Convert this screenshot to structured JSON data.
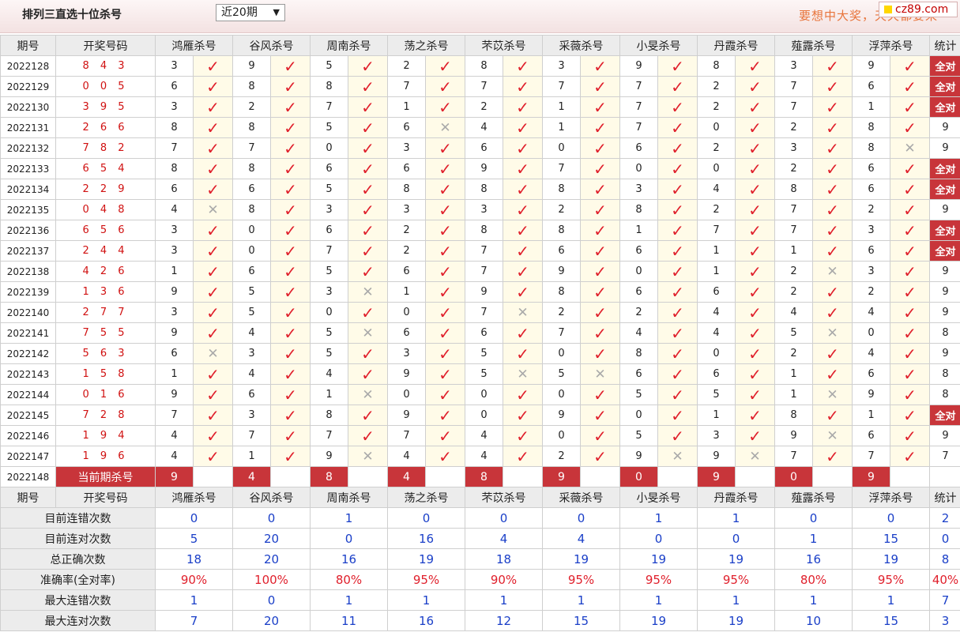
{
  "header": {
    "title": "排列三直选十位杀号",
    "range_selected": "近20期",
    "slogan": "要想中大奖，天天都要来",
    "site_badge": "cz89.com"
  },
  "columns": {
    "issue": "期号",
    "draw": "开奖号码",
    "experts": [
      "鸿雁杀号",
      "谷风杀号",
      "周南杀号",
      "荡之杀号",
      "芣苡杀号",
      "采薇杀号",
      "小旻杀号",
      "丹霞杀号",
      "薤露杀号",
      "浮萍杀号"
    ],
    "stat": "统计"
  },
  "rows": [
    {
      "issue": "2022128",
      "draw": "8 4 3",
      "kills": [
        3,
        9,
        5,
        2,
        8,
        3,
        9,
        8,
        3,
        9
      ],
      "ok": [
        1,
        1,
        1,
        1,
        1,
        1,
        1,
        1,
        1,
        1
      ],
      "stat": "全对"
    },
    {
      "issue": "2022129",
      "draw": "0 0 5",
      "kills": [
        6,
        8,
        8,
        7,
        7,
        7,
        7,
        2,
        7,
        6
      ],
      "ok": [
        1,
        1,
        1,
        1,
        1,
        1,
        1,
        1,
        1,
        1
      ],
      "stat": "全对"
    },
    {
      "issue": "2022130",
      "draw": "3 9 5",
      "kills": [
        3,
        2,
        7,
        1,
        2,
        1,
        7,
        2,
        7,
        1
      ],
      "ok": [
        1,
        1,
        1,
        1,
        1,
        1,
        1,
        1,
        1,
        1
      ],
      "stat": "全对"
    },
    {
      "issue": "2022131",
      "draw": "2 6 6",
      "kills": [
        8,
        8,
        5,
        6,
        4,
        1,
        7,
        0,
        2,
        8
      ],
      "ok": [
        1,
        1,
        1,
        0,
        1,
        1,
        1,
        1,
        1,
        1
      ],
      "stat": "9"
    },
    {
      "issue": "2022132",
      "draw": "7 8 2",
      "kills": [
        7,
        7,
        0,
        3,
        6,
        0,
        6,
        2,
        3,
        8
      ],
      "ok": [
        1,
        1,
        1,
        1,
        1,
        1,
        1,
        1,
        1,
        0
      ],
      "stat": "9"
    },
    {
      "issue": "2022133",
      "draw": "6 5 4",
      "kills": [
        8,
        8,
        6,
        6,
        9,
        7,
        0,
        0,
        2,
        6
      ],
      "ok": [
        1,
        1,
        1,
        1,
        1,
        1,
        1,
        1,
        1,
        1
      ],
      "stat": "全对"
    },
    {
      "issue": "2022134",
      "draw": "2 2 9",
      "kills": [
        6,
        6,
        5,
        8,
        8,
        8,
        3,
        4,
        8,
        6
      ],
      "ok": [
        1,
        1,
        1,
        1,
        1,
        1,
        1,
        1,
        1,
        1
      ],
      "stat": "全对"
    },
    {
      "issue": "2022135",
      "draw": "0 4 8",
      "kills": [
        4,
        8,
        3,
        3,
        3,
        2,
        8,
        2,
        7,
        2
      ],
      "ok": [
        0,
        1,
        1,
        1,
        1,
        1,
        1,
        1,
        1,
        1
      ],
      "stat": "9"
    },
    {
      "issue": "2022136",
      "draw": "6 5 6",
      "kills": [
        3,
        0,
        6,
        2,
        8,
        8,
        1,
        7,
        7,
        3
      ],
      "ok": [
        1,
        1,
        1,
        1,
        1,
        1,
        1,
        1,
        1,
        1
      ],
      "stat": "全对"
    },
    {
      "issue": "2022137",
      "draw": "2 4 4",
      "kills": [
        3,
        0,
        7,
        2,
        7,
        6,
        6,
        1,
        1,
        6
      ],
      "ok": [
        1,
        1,
        1,
        1,
        1,
        1,
        1,
        1,
        1,
        1
      ],
      "stat": "全对"
    },
    {
      "issue": "2022138",
      "draw": "4 2 6",
      "kills": [
        1,
        6,
        5,
        6,
        7,
        9,
        0,
        1,
        2,
        3
      ],
      "ok": [
        1,
        1,
        1,
        1,
        1,
        1,
        1,
        1,
        0,
        1
      ],
      "stat": "9"
    },
    {
      "issue": "2022139",
      "draw": "1 3 6",
      "kills": [
        9,
        5,
        3,
        1,
        9,
        8,
        6,
        6,
        2,
        2
      ],
      "ok": [
        1,
        1,
        0,
        1,
        1,
        1,
        1,
        1,
        1,
        1
      ],
      "stat": "9"
    },
    {
      "issue": "2022140",
      "draw": "2 7 7",
      "kills": [
        3,
        5,
        0,
        0,
        7,
        2,
        2,
        4,
        4,
        4
      ],
      "ok": [
        1,
        1,
        1,
        1,
        0,
        1,
        1,
        1,
        1,
        1
      ],
      "stat": "9"
    },
    {
      "issue": "2022141",
      "draw": "7 5 5",
      "kills": [
        9,
        4,
        5,
        6,
        6,
        7,
        4,
        4,
        5,
        0
      ],
      "ok": [
        1,
        1,
        0,
        1,
        1,
        1,
        1,
        1,
        0,
        1
      ],
      "stat": "8"
    },
    {
      "issue": "2022142",
      "draw": "5 6 3",
      "kills": [
        6,
        3,
        5,
        3,
        5,
        0,
        8,
        0,
        2,
        4
      ],
      "ok": [
        0,
        1,
        1,
        1,
        1,
        1,
        1,
        1,
        1,
        1
      ],
      "stat": "9"
    },
    {
      "issue": "2022143",
      "draw": "1 5 8",
      "kills": [
        1,
        4,
        4,
        9,
        5,
        5,
        6,
        6,
        1,
        6
      ],
      "ok": [
        1,
        1,
        1,
        1,
        0,
        0,
        1,
        1,
        1,
        1
      ],
      "stat": "8"
    },
    {
      "issue": "2022144",
      "draw": "0 1 6",
      "kills": [
        9,
        6,
        1,
        0,
        0,
        0,
        5,
        5,
        1,
        9
      ],
      "ok": [
        1,
        1,
        0,
        1,
        1,
        1,
        1,
        1,
        0,
        1
      ],
      "stat": "8"
    },
    {
      "issue": "2022145",
      "draw": "7 2 8",
      "kills": [
        7,
        3,
        8,
        9,
        0,
        9,
        0,
        1,
        8,
        1
      ],
      "ok": [
        1,
        1,
        1,
        1,
        1,
        1,
        1,
        1,
        1,
        1
      ],
      "stat": "全对"
    },
    {
      "issue": "2022146",
      "draw": "1 9 4",
      "kills": [
        4,
        7,
        7,
        7,
        4,
        0,
        5,
        3,
        9,
        6
      ],
      "ok": [
        1,
        1,
        1,
        1,
        1,
        1,
        1,
        1,
        0,
        1
      ],
      "stat": "9"
    },
    {
      "issue": "2022147",
      "draw": "1 9 6",
      "kills": [
        4,
        1,
        9,
        4,
        4,
        2,
        9,
        9,
        7,
        7
      ],
      "ok": [
        1,
        1,
        0,
        1,
        1,
        1,
        0,
        0,
        1,
        1
      ],
      "stat": "7"
    }
  ],
  "current": {
    "issue": "2022148",
    "label": "当前期杀号",
    "kills": [
      9,
      4,
      8,
      4,
      8,
      9,
      0,
      9,
      0,
      9
    ]
  },
  "stats": [
    {
      "label": "目前连错次数",
      "values": [
        "0",
        "0",
        "1",
        "0",
        "0",
        "0",
        "1",
        "1",
        "0",
        "0"
      ],
      "total": "2"
    },
    {
      "label": "目前连对次数",
      "values": [
        "5",
        "20",
        "0",
        "16",
        "4",
        "4",
        "0",
        "0",
        "1",
        "15"
      ],
      "total": "0"
    },
    {
      "label": "总正确次数",
      "values": [
        "18",
        "20",
        "16",
        "19",
        "18",
        "19",
        "19",
        "19",
        "16",
        "19"
      ],
      "total": "8"
    },
    {
      "label": "准确率(全对率)",
      "values": [
        "90%",
        "100%",
        "80%",
        "95%",
        "90%",
        "95%",
        "95%",
        "95%",
        "80%",
        "95%"
      ],
      "total": "40%",
      "red": true
    },
    {
      "label": "最大连错次数",
      "values": [
        "1",
        "0",
        "1",
        "1",
        "1",
        "1",
        "1",
        "1",
        "1",
        "1"
      ],
      "total": "7"
    },
    {
      "label": "最大连对次数",
      "values": [
        "7",
        "20",
        "11",
        "16",
        "12",
        "15",
        "19",
        "19",
        "10",
        "15"
      ],
      "total": "3"
    }
  ],
  "icons": {
    "correct": "check-icon",
    "wrong": "cross-icon"
  },
  "colors": {
    "accent": "#c8353a",
    "check": "#e0202c",
    "stat_blue": "#1a3fc8"
  }
}
